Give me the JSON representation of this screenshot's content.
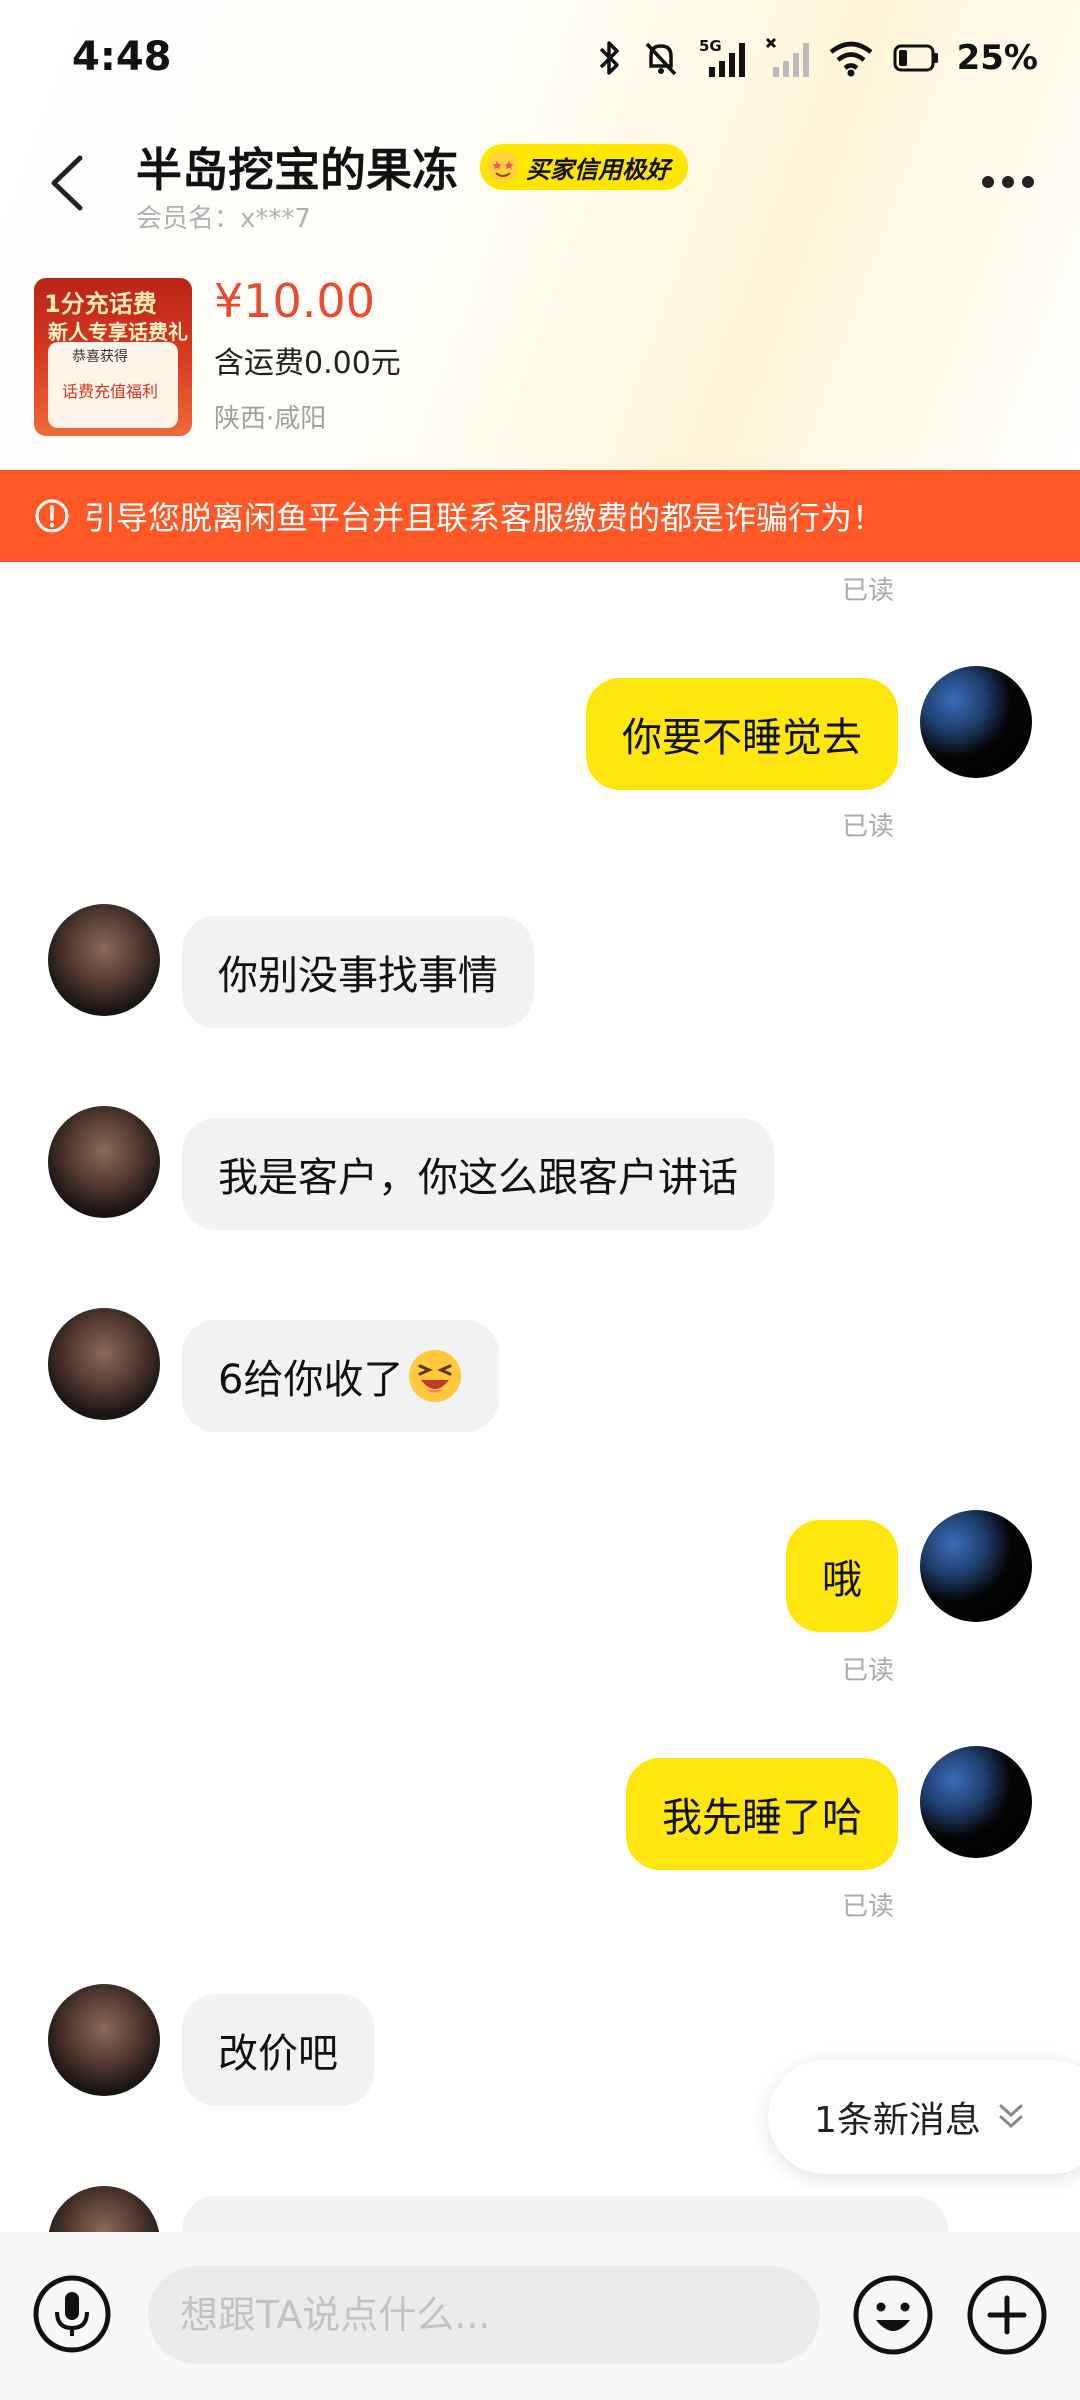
{
  "status_bar": {
    "time": "4:48",
    "network": "5G",
    "battery": "25%"
  },
  "header": {
    "nickname": "半岛挖宝的果冻",
    "credit_badge": "买家信用极好",
    "member_name": "会员名：x***7"
  },
  "product": {
    "price": "¥10.00",
    "shipping": "含运费0.00元",
    "location": "陕西·咸阳",
    "thumb_title": "1分充话费",
    "thumb_subtitle": "新人专享话费礼",
    "thumb_card_top": "恭喜获得",
    "thumb_card_label": "话费充值福利"
  },
  "warning": {
    "text": "引导您脱离闲鱼平台并且联系客服缴费的都是诈骗行为！"
  },
  "chat": {
    "read_label": "已读",
    "messages": [
      {
        "from": "me",
        "text": "你要不睡觉去",
        "status": "已读"
      },
      {
        "from": "other",
        "text": "你别没事找事情"
      },
      {
        "from": "other",
        "text": "我是客户，你这么跟客户讲话"
      },
      {
        "from": "other",
        "text": "6给你收了",
        "emoji": "laughing-emoji"
      },
      {
        "from": "me",
        "text": "哦",
        "status": "已读"
      },
      {
        "from": "me",
        "text": "我先睡了哈",
        "status": "已读"
      },
      {
        "from": "other",
        "text": "改价吧"
      }
    ]
  },
  "new_messages": {
    "label": "1条新消息"
  },
  "input": {
    "placeholder": "想跟TA说点什么..."
  },
  "colors": {
    "accent_yellow": "#ffe60f",
    "warning_orange": "#ff5726",
    "price_red": "#ea4a2f"
  },
  "icons": [
    "back-arrow-icon",
    "more-icon",
    "warning-icon",
    "microphone-icon",
    "emoji-icon",
    "plus-icon",
    "chevron-double-down-icon"
  ]
}
